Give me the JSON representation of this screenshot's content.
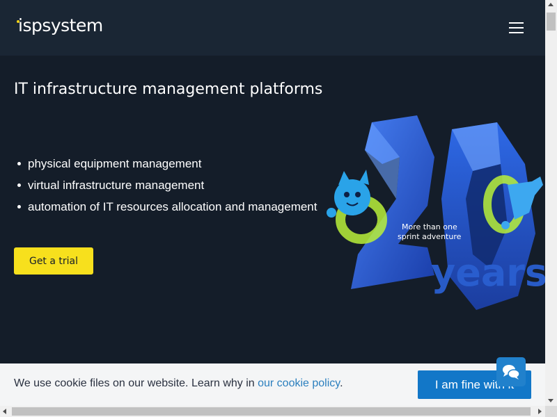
{
  "header": {
    "logo_text": "ispsystem",
    "logo_dot_color": "#f5d417",
    "menu_icon": "hamburger-menu-icon"
  },
  "main": {
    "title": "IT infrastructure management platforms",
    "features": [
      "physical equipment management",
      "virtual infrastructure management",
      "automation of IT resources allocation and management"
    ],
    "cta_label": "Get a trial",
    "cta_color": "#f7e01d"
  },
  "promo": {
    "number_art": "20",
    "years_text": "years",
    "tagline_line1": "More than one",
    "tagline_line2": "sprint adventure",
    "mascot": "cat-mascot-icon"
  },
  "cookie": {
    "text": "We use cookie files on our website. Learn why in ",
    "link_text": "our cookie policy",
    "after_link": ".",
    "accept_label": "I am fine with it",
    "accept_color": "#1277c8"
  },
  "chat": {
    "icon": "chat-bubbles-icon"
  }
}
